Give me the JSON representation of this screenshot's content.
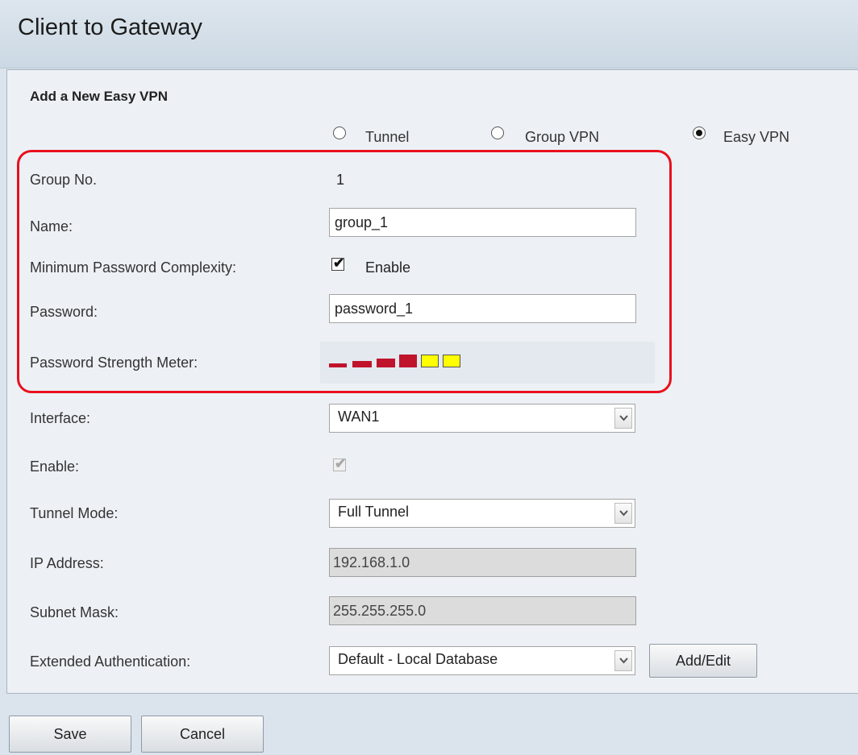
{
  "page": {
    "title": "Client to Gateway"
  },
  "form": {
    "section_title": "Add a New Easy VPN",
    "type_options": [
      {
        "label": "Tunnel",
        "checked": false
      },
      {
        "label": "Group VPN",
        "checked": false
      },
      {
        "label": "Easy VPN",
        "checked": true
      }
    ],
    "group_no": {
      "label": "Group No.",
      "value": "1"
    },
    "name": {
      "label": "Name:",
      "value": "group_1"
    },
    "min_password_complexity": {
      "label": "Minimum Password Complexity:",
      "checkbox_label": "Enable",
      "checked": true
    },
    "password": {
      "label": "Password:",
      "value": "password_1"
    },
    "strength_meter": {
      "label": "Password Strength Meter:",
      "segments": [
        {
          "color": "#c0142c",
          "filled": false
        },
        {
          "color": "#c0142c",
          "filled": false
        },
        {
          "color": "#c0142c",
          "filled": false
        },
        {
          "color": "#c0142c",
          "filled": true
        },
        {
          "color": "#ffff00",
          "filled": true
        },
        {
          "color": "#ffff00",
          "filled": true
        }
      ]
    },
    "interface": {
      "label": "Interface:",
      "value": "WAN1"
    },
    "enable": {
      "label": "Enable:",
      "checked": true,
      "disabled": true
    },
    "tunnel_mode": {
      "label": "Tunnel Mode:",
      "value": "Full Tunnel"
    },
    "ip_address": {
      "label": "IP Address:",
      "value": "192.168.1.0"
    },
    "subnet_mask": {
      "label": "Subnet Mask:",
      "value": "255.255.255.0"
    },
    "extended_auth": {
      "label": "Extended Authentication:",
      "value": "Default - Local Database",
      "button": "Add/Edit"
    }
  },
  "actions": {
    "save": "Save",
    "cancel": "Cancel"
  },
  "colors": {
    "highlight": "#e8101e",
    "panel": "#edf1f5",
    "header": "#dbe4ec"
  }
}
